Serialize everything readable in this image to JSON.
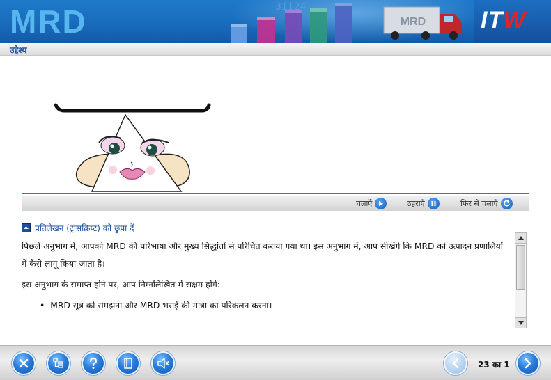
{
  "header": {
    "logo_text": "MRD",
    "brand_left": "IT",
    "brand_right": "W",
    "truck_label": "MRD",
    "colors": {
      "header_blue": "#1a6fbf",
      "logo_cyan": "#58b6ee",
      "brand_red": "#e02424"
    }
  },
  "section": {
    "title": "उद्देश्य"
  },
  "media": {
    "play_label": "चलाएँ",
    "pause_label": "ठहराएँ",
    "replay_label": "फिर से चलाएँ",
    "play_icon": "play-icon",
    "pause_icon": "pause-icon",
    "replay_icon": "replay-icon"
  },
  "transcript": {
    "toggle_icon": "collapse-icon",
    "toggle_label": "प्रतिलेखन (ट्रांसक्रिप्ट) को छुपा दें",
    "paragraph1": "पिछले अनुभाग में, आपको MRD की परिभाषा और मुख्य सिद्धांतों से परिचित कराया गया था। इस अनुभाग में, आप सीखेंगे कि MRD को उत्पादन प्रणालियों में कैसे लागू किया जाता है।",
    "paragraph2": "इस अनुभाग के समाप्त होने पर, आप निम्नलिखित में सक्षम होंगे:",
    "bullets": [
      "MRD सूत्र को समझना और MRD भराई की मात्रा का परिकलन करना।"
    ]
  },
  "footer": {
    "buttons": [
      {
        "name": "exit-button",
        "icon": "close-icon"
      },
      {
        "name": "menu-button",
        "icon": "tree-menu-icon"
      },
      {
        "name": "help-button",
        "icon": "help-icon"
      },
      {
        "name": "glossary-button",
        "icon": "book-icon"
      },
      {
        "name": "audio-button",
        "icon": "speaker-icon"
      }
    ],
    "page_indicator": "23 का 1",
    "prev_icon": "chevron-left-icon",
    "next_icon": "chevron-right-icon"
  }
}
